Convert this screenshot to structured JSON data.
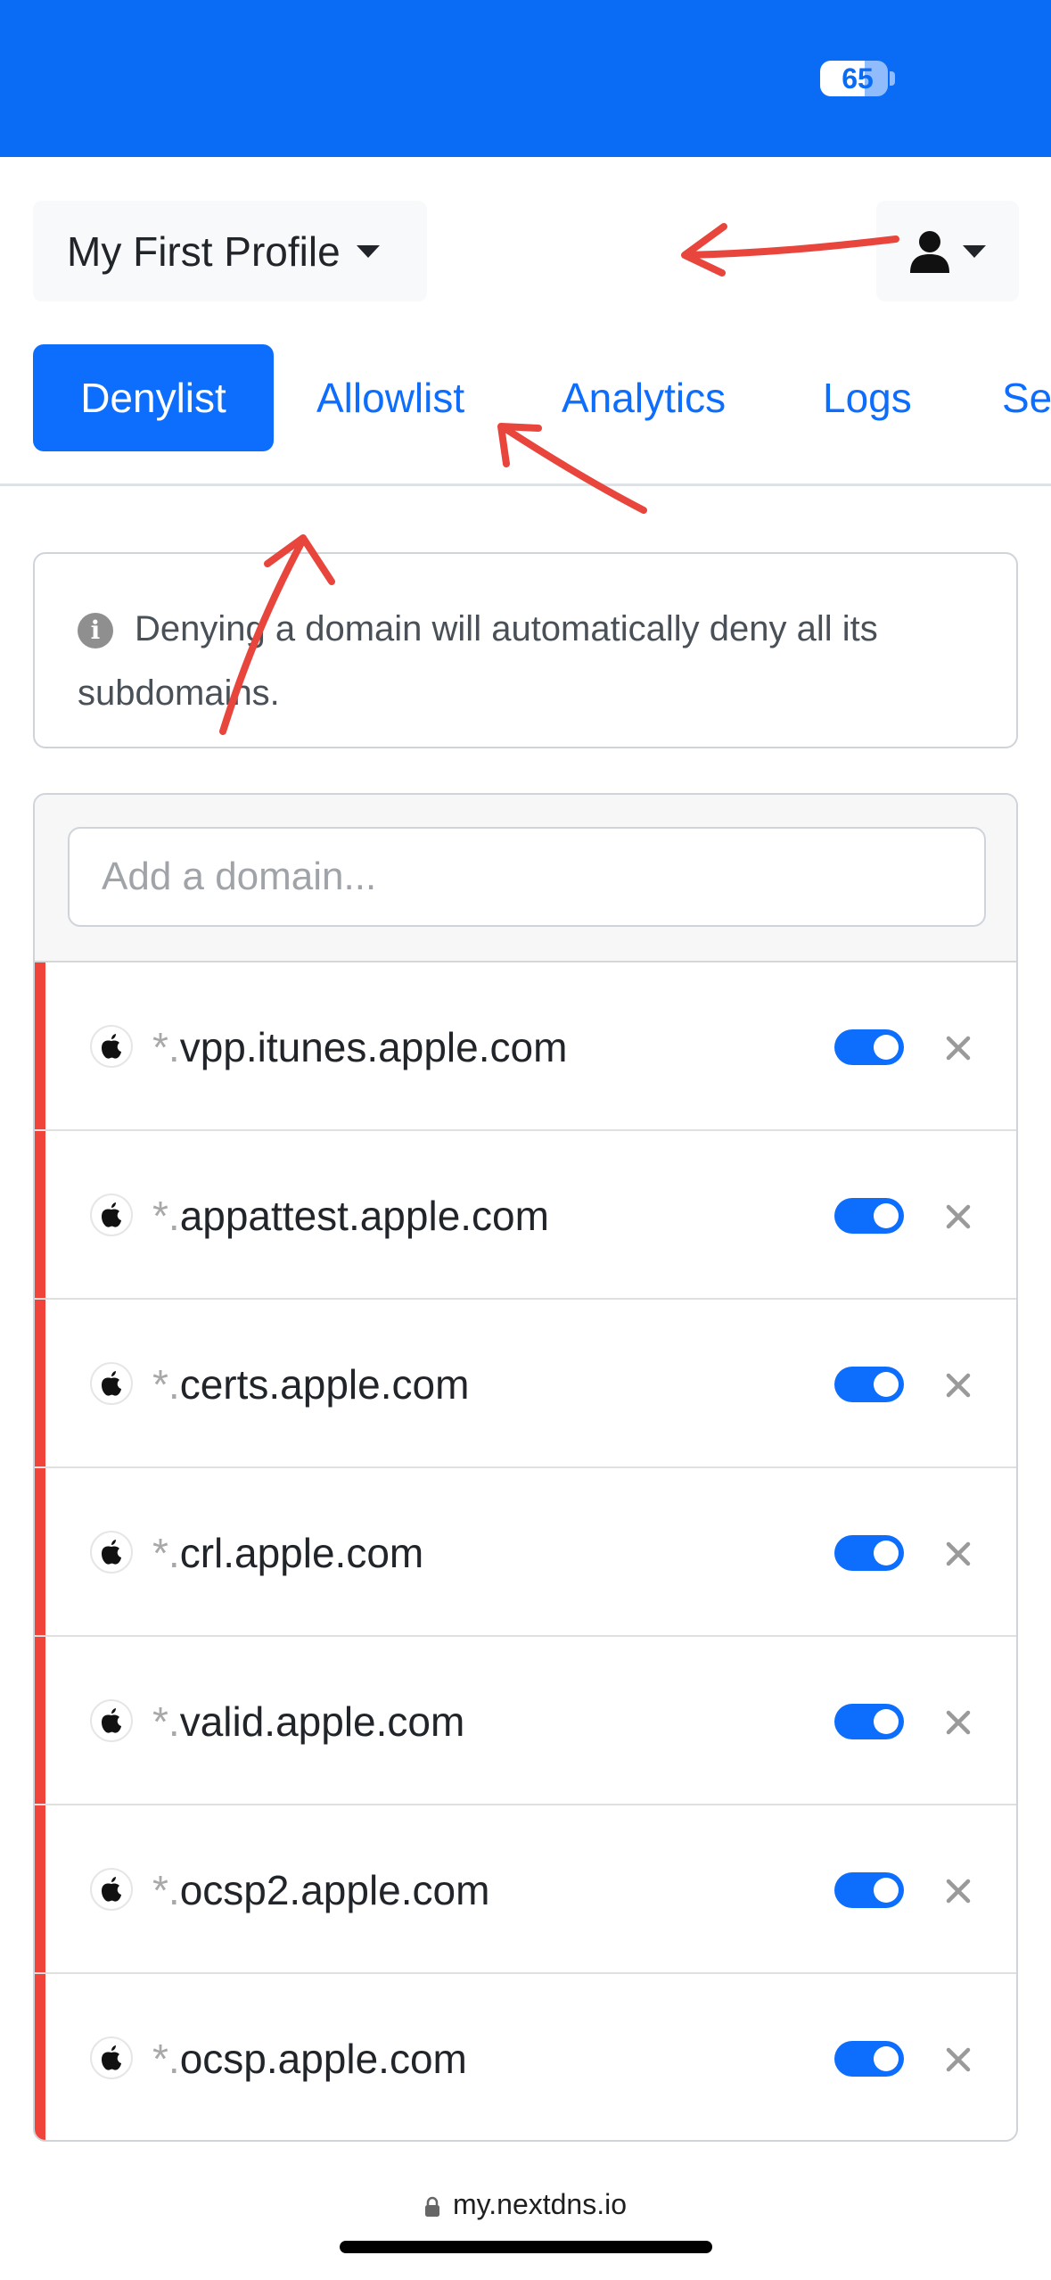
{
  "status_bar": {
    "battery_level": "65",
    "color": "#0a6cf5"
  },
  "header": {
    "profile_name": "My First Profile",
    "user_menu_icon": "user-icon"
  },
  "tabs": [
    {
      "label": "Denylist",
      "active": true
    },
    {
      "label": "Allowlist",
      "active": false
    },
    {
      "label": "Analytics",
      "active": false
    },
    {
      "label": "Logs",
      "active": false
    },
    {
      "label": "Se",
      "active": false
    }
  ],
  "info": {
    "icon": "info-icon",
    "line1": "Denying a domain will automatically deny all its",
    "line2": "subdomains."
  },
  "add_domain": {
    "placeholder": "Add a domain...",
    "value": ""
  },
  "domains": [
    {
      "prefix": "*.",
      "name": "vpp.itunes.apple.com",
      "enabled": true
    },
    {
      "prefix": "*.",
      "name": "appattest.apple.com",
      "enabled": true
    },
    {
      "prefix": "*.",
      "name": "certs.apple.com",
      "enabled": true
    },
    {
      "prefix": "*.",
      "name": "crl.apple.com",
      "enabled": true
    },
    {
      "prefix": "*.",
      "name": "valid.apple.com",
      "enabled": true
    },
    {
      "prefix": "*.",
      "name": "ocsp2.apple.com",
      "enabled": true
    },
    {
      "prefix": "*.",
      "name": "ocsp.apple.com",
      "enabled": true
    }
  ],
  "browser": {
    "url": "my.nextdns.io"
  },
  "colors": {
    "primary": "#0d6efd",
    "deny_bar": "#f0443a",
    "annotation": "#e8453c"
  }
}
